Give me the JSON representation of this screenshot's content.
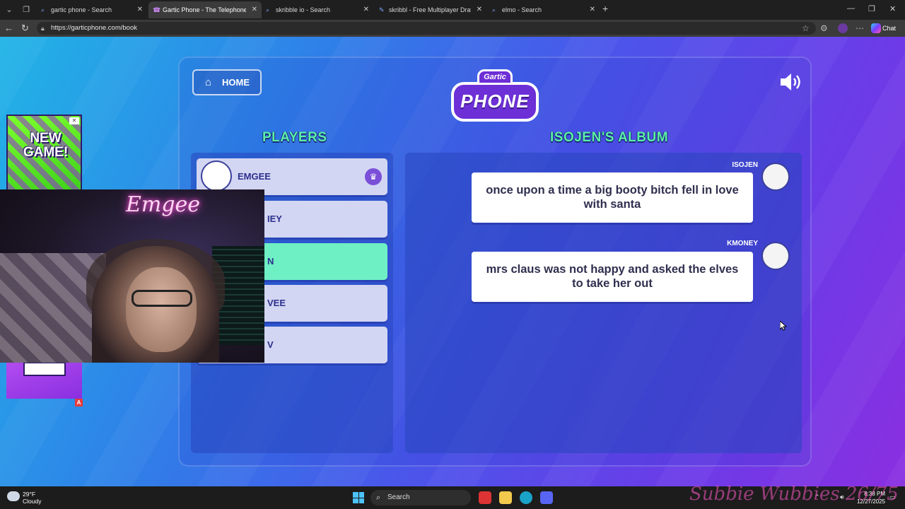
{
  "browser": {
    "tabs": [
      {
        "label": "gartic phone - Search",
        "icon": "search-icon"
      },
      {
        "label": "Gartic Phone - The Telephone Gam",
        "icon": "phone-icon"
      },
      {
        "label": "skribble io - Search",
        "icon": "search-icon"
      },
      {
        "label": "skribbl - Free Multiplayer Drawing",
        "icon": "pen-icon"
      },
      {
        "label": "elmo - Search",
        "icon": "search-icon"
      }
    ],
    "url": "https://garticphone.com/book",
    "chat_label": "Chat"
  },
  "game": {
    "home_label": "HOME",
    "logo_top": "Gartic",
    "logo_main": "PHONE",
    "players_title": "PLAYERS",
    "album_title": "ISOJEN'S ALBUM",
    "players": [
      {
        "name": "EMGEE",
        "host": true
      },
      {
        "name": "IEY"
      },
      {
        "name": "N",
        "current": true
      },
      {
        "name": "VEE"
      },
      {
        "name": "V"
      }
    ],
    "messages": [
      {
        "author": "ISOJEN",
        "text": "once upon a time a big booty bitch fell in love with santa"
      },
      {
        "author": "KMONEY",
        "text": "mrs claus was not happy and asked the elves to take her out"
      }
    ]
  },
  "ads": {
    "top_text": "NEW GAME!",
    "badge": "A"
  },
  "webcam": {
    "neon_text": "Emgee"
  },
  "taskbar": {
    "temp": "29°F",
    "condition": "Cloudy",
    "search_label": "Search",
    "time": "8:38 PM",
    "date": "12/27/2025",
    "watermark": "Subbie Wubbies 26/75"
  }
}
